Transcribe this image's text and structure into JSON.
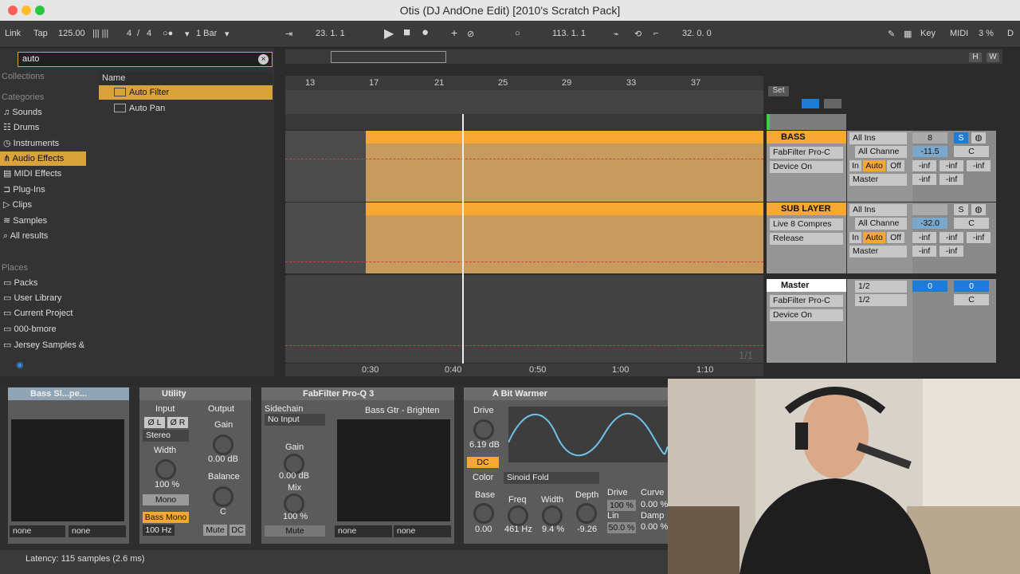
{
  "window": {
    "title": "Otis (DJ AndOne Edit)  [2010's Scratch Pack]"
  },
  "control_bar": {
    "link": "Link",
    "tap": "Tap",
    "tempo": "125.00",
    "sig_num": "4",
    "sig_slash": "/",
    "sig_den": "4",
    "quant": "1 Bar",
    "arr_pos": "23.   1.   1",
    "loop_start": "113.   1.   1",
    "loop_len": "32.   0.   0",
    "key": "Key",
    "midi": "MIDI",
    "cpu": "3 %",
    "d": "D"
  },
  "browser": {
    "search_value": "auto",
    "collections_label": "Collections",
    "categories_label": "Categories",
    "categories": [
      "Sounds",
      "Drums",
      "Instruments",
      "Audio Effects",
      "MIDI Effects",
      "Plug-Ins",
      "Clips",
      "Samples",
      "All results"
    ],
    "places_label": "Places",
    "places": [
      "Packs",
      "User Library",
      "Current Project",
      "000-bmore",
      "Jersey Samples &"
    ],
    "col_name": "Name",
    "results": [
      "Auto Filter",
      "Auto Pan"
    ]
  },
  "arrangement": {
    "ruler": [
      "13",
      "17",
      "21",
      "25",
      "29",
      "33",
      "37"
    ],
    "time": [
      "0:30",
      "0:40",
      "0:50",
      "1:00",
      "1:10"
    ],
    "set": "Set",
    "hw": [
      "H",
      "W"
    ],
    "page": "1/1"
  },
  "tracks": [
    {
      "name": "BASS",
      "device": "FabFilter Pro-C",
      "param": "Device On",
      "input": "All Ins",
      "channel": "All Channe",
      "output": "Master",
      "track_no": "8",
      "s": "S",
      "vol": "-11.5",
      "pan": "C",
      "sends": [
        "-inf",
        "-inf",
        "-inf",
        "-inf",
        "-inf"
      ]
    },
    {
      "name": "SUB LAYER",
      "device": "Live 8 Compres",
      "param": "Release",
      "input": "All Ins",
      "channel": "All Channe",
      "output": "Master",
      "track_no": "",
      "s": "S",
      "vol": "-32.0",
      "pan": "C",
      "sends": [
        "-inf",
        "-inf",
        "-inf",
        "-inf",
        "-inf"
      ]
    }
  ],
  "master": {
    "name": "Master",
    "device": "FabFilter Pro-C",
    "param": "Device On",
    "cue1": "1/2",
    "cue2": "1/2",
    "vol": "0",
    "vol2": "0",
    "pan": "C"
  },
  "monitor": {
    "in": "In",
    "auto": "Auto",
    "off": "Off"
  },
  "devices": {
    "bass": {
      "title": "Bass Sl...pe...",
      "sel1": "none",
      "sel2": "none"
    },
    "utility": {
      "title": "Utility",
      "input": "Input",
      "output": "Output",
      "phl": "Ø L",
      "phr": "Ø R",
      "stereo": "Stereo",
      "gain": "Gain",
      "gain_val": "0.00 dB",
      "width": "Width",
      "width_val": "100 %",
      "balance": "Balance",
      "balance_val": "C",
      "mono": "Mono",
      "bass_mono": "Bass Mono",
      "hz": "100 Hz",
      "mute": "Mute",
      "dc": "DC"
    },
    "proq": {
      "title": "FabFilter Pro-Q 3",
      "sidechain": "Sidechain",
      "no_input": "No Input",
      "gain": "Gain",
      "gain_val": "0.00 dB",
      "mix": "Mix",
      "mix_val": "100 %",
      "mute": "Mute",
      "preset": "Bass Gtr - Brighten",
      "none1": "none",
      "none2": "none"
    },
    "warmer": {
      "title": "A Bit Warmer",
      "drive": "Drive",
      "drive_val": "6.19 dB",
      "dc": "DC",
      "color": "Color",
      "mode": "Sinoid Fold",
      "base": "Base",
      "base_val": "0.00",
      "freq": "Freq",
      "freq_val": "461 Hz",
      "width": "Width",
      "width_val": "9.4 %",
      "depth": "Depth",
      "depth_val": "-9.26",
      "drive2": "Drive",
      "drive2_val": "100 %",
      "curve": "Curve",
      "curve_val": "0.00 %",
      "lin": "Lin",
      "lin_val": "50.0 %",
      "damp": "Damp",
      "damp_val": "0.00 %"
    }
  },
  "status": {
    "latency": "Latency: 115 samples (2.6 ms)"
  },
  "colors": {
    "accent": "#f7a832",
    "clip": "#c69b5d",
    "select": "#d9a23a",
    "blue": "#1e7bd6"
  }
}
